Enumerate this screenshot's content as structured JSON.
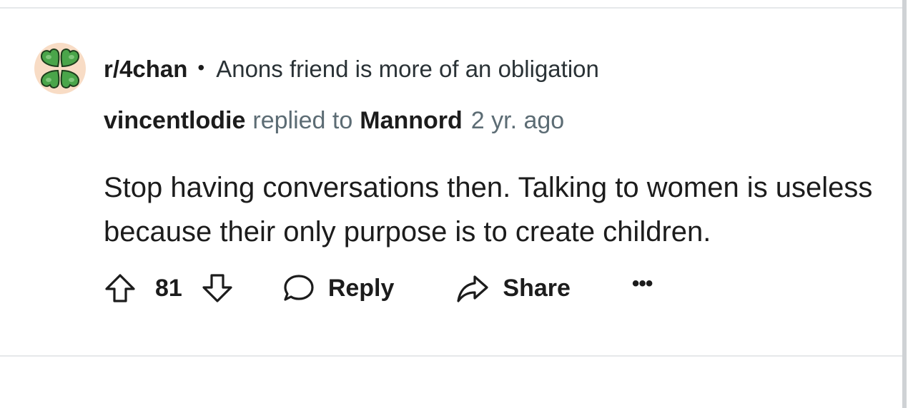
{
  "comment": {
    "subreddit": "r/4chan",
    "separator": "•",
    "post_title": "Anons friend is more of an obligation",
    "author": "vincentlodie",
    "replied_to_text": "replied to",
    "replied_to_user": "Mannord",
    "time": "2 yr. ago",
    "body": "Stop having conversations then. Talking to women is useless because their only purpose is to create children."
  },
  "actions": {
    "upvote_icon": "arrow-up-icon",
    "vote_count": "81",
    "downvote_icon": "arrow-down-icon",
    "reply_label": "Reply",
    "reply_icon": "speech-bubble-icon",
    "share_label": "Share",
    "share_icon": "share-arrow-icon",
    "more_label": "•••"
  },
  "colors": {
    "text": "#1c1c1c",
    "muted": "#5c6c74",
    "avatar_bg": "#f8dcc5",
    "clover_green": "#46a047",
    "divider": "#e6e8ea"
  }
}
